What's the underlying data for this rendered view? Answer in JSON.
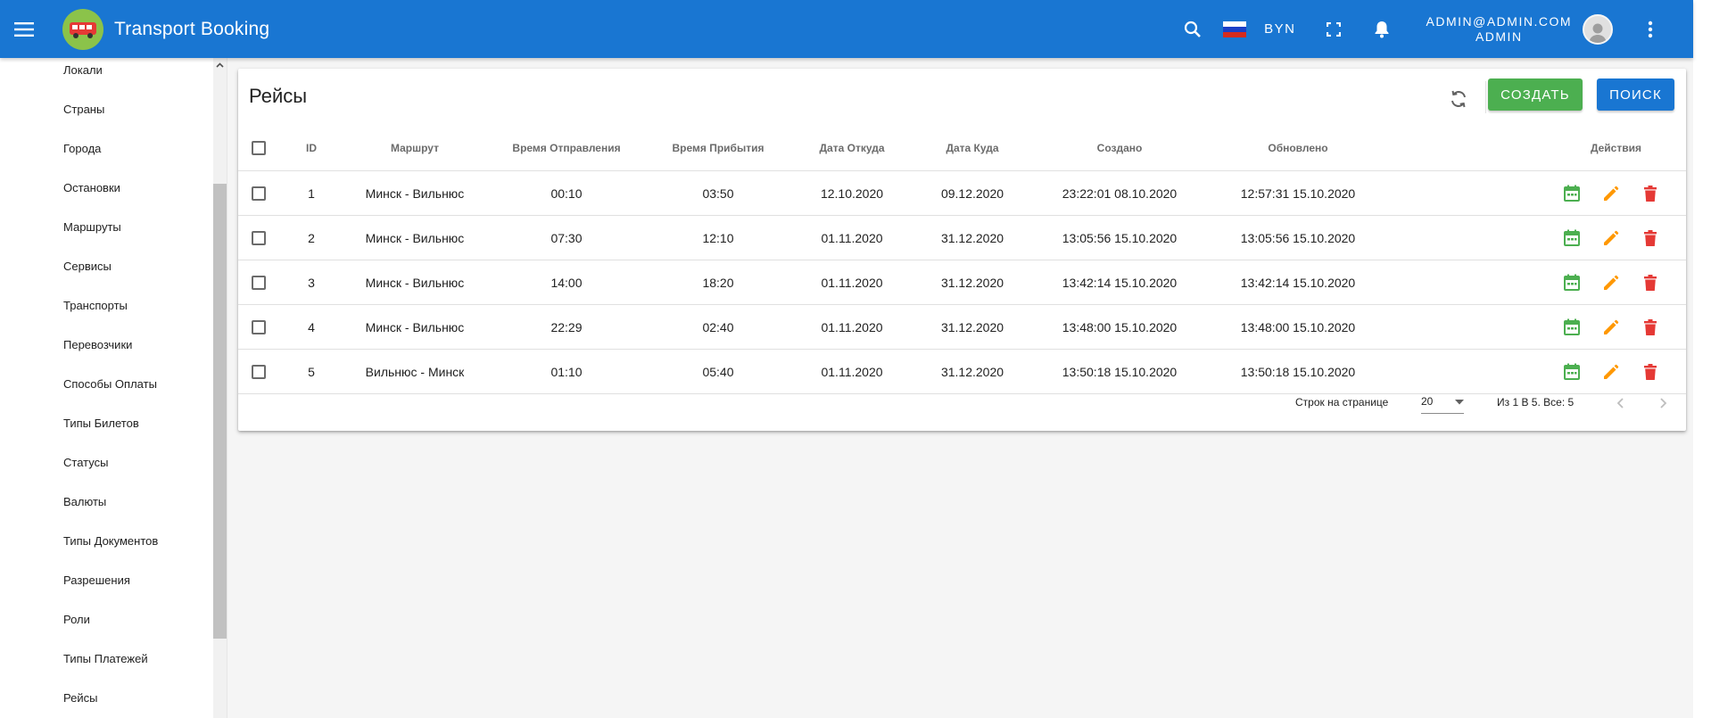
{
  "app": {
    "title": "Transport Booking"
  },
  "header": {
    "currency": "BYN",
    "user_email": "ADMIN@ADMIN.COM",
    "user_role": "ADMIN",
    "flag_colors": [
      "#ffffff",
      "#1a3fc7",
      "#d52b1e"
    ]
  },
  "sidebar": {
    "items": [
      {
        "label": "Локали"
      },
      {
        "label": "Страны"
      },
      {
        "label": "Города"
      },
      {
        "label": "Остановки"
      },
      {
        "label": "Маршруты"
      },
      {
        "label": "Сервисы"
      },
      {
        "label": "Транспорты"
      },
      {
        "label": "Перевозчики"
      },
      {
        "label": "Способы Оплаты"
      },
      {
        "label": "Типы Билетов"
      },
      {
        "label": "Статусы"
      },
      {
        "label": "Валюты"
      },
      {
        "label": "Типы Документов"
      },
      {
        "label": "Разрешения"
      },
      {
        "label": "Роли"
      },
      {
        "label": "Типы Платежей"
      },
      {
        "label": "Рейсы"
      }
    ]
  },
  "page": {
    "title": "Рейсы",
    "create_label": "СОЗДАТЬ",
    "search_label": "ПОИСК"
  },
  "table": {
    "headers": {
      "id": "ID",
      "route": "Маршрут",
      "departure_time": "Время Отправления",
      "arrival_time": "Время Прибытия",
      "date_from": "Дата Откуда",
      "date_to": "Дата Куда",
      "created": "Создано",
      "updated": "Обновлено",
      "actions": "Действия"
    },
    "rows": [
      {
        "id": "1",
        "route": "Минск - Вильнюс",
        "departure_time": "00:10",
        "arrival_time": "03:50",
        "date_from": "12.10.2020",
        "date_to": "09.12.2020",
        "created": "23:22:01 08.10.2020",
        "updated": "12:57:31 15.10.2020"
      },
      {
        "id": "2",
        "route": "Минск - Вильнюс",
        "departure_time": "07:30",
        "arrival_time": "12:10",
        "date_from": "01.11.2020",
        "date_to": "31.12.2020",
        "created": "13:05:56 15.10.2020",
        "updated": "13:05:56 15.10.2020"
      },
      {
        "id": "3",
        "route": "Минск - Вильнюс",
        "departure_time": "14:00",
        "arrival_time": "18:20",
        "date_from": "01.11.2020",
        "date_to": "31.12.2020",
        "created": "13:42:14 15.10.2020",
        "updated": "13:42:14 15.10.2020"
      },
      {
        "id": "4",
        "route": "Минск - Вильнюс",
        "departure_time": "22:29",
        "arrival_time": "02:40",
        "date_from": "01.11.2020",
        "date_to": "31.12.2020",
        "created": "13:48:00 15.10.2020",
        "updated": "13:48:00 15.10.2020"
      },
      {
        "id": "5",
        "route": "Вильнюс - Минск",
        "departure_time": "01:10",
        "arrival_time": "05:40",
        "date_from": "01.11.2020",
        "date_to": "31.12.2020",
        "created": "13:50:18 15.10.2020",
        "updated": "13:50:18 15.10.2020"
      }
    ]
  },
  "pagination": {
    "rows_per_page_label": "Строк на странице",
    "rows_per_page_value": "20",
    "range_label": "Из 1 В 5. Все: 5"
  },
  "colors": {
    "primary": "#1976d2",
    "create": "#4caf50",
    "calendar_icon": "#4caf50",
    "edit_icon": "#ff9800",
    "delete_icon": "#e53935"
  }
}
